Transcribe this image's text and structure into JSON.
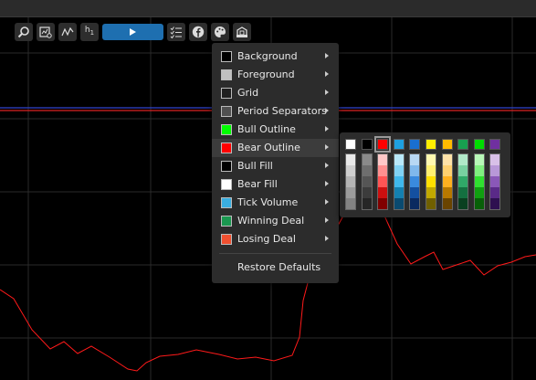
{
  "chart": {
    "background": "#000000",
    "grid_color": "#2a2a2a",
    "line_color": "#ff1a1a",
    "hline_blue": "#3344cc",
    "hline_red": "#dd2222"
  },
  "toolbar": {
    "icons": [
      "zoom-icon",
      "chart-settings-icon",
      "indicator-icon",
      "timeframe-icon",
      "play-icon",
      "checklist-icon",
      "facebook-icon",
      "color-palette-icon",
      "template-icon"
    ],
    "timeframe_letter": "h",
    "timeframe_number": "1",
    "play_color": "#1e6fb0"
  },
  "menu": {
    "items": [
      {
        "label": "Background",
        "color": "#000000"
      },
      {
        "label": "Foreground",
        "color": "#c0c0c0"
      },
      {
        "label": "Grid",
        "color": "#202020"
      },
      {
        "label": "Period Separators",
        "color": "#505050"
      },
      {
        "label": "Bull Outline",
        "color": "#00ff00"
      },
      {
        "label": "Bear Outline",
        "color": "#ff0000"
      },
      {
        "label": "Bull Fill",
        "color": "#000000"
      },
      {
        "label": "Bear Fill",
        "color": "#ffffff"
      },
      {
        "label": "Tick Volume",
        "color": "#3aaee0"
      },
      {
        "label": "Winning Deal",
        "color": "#1a9850"
      },
      {
        "label": "Losing Deal",
        "color": "#f05030"
      }
    ],
    "highlighted_index": 5,
    "restore_label": "Restore Defaults"
  },
  "palette": {
    "top_colors": [
      "#ffffff",
      "#000000",
      "#ff0000",
      "#1ea0e0",
      "#1a6fd0",
      "#ffee00",
      "#ffbb00",
      "#18a050",
      "#00dd00",
      "#7030a0"
    ],
    "selected_index": 2,
    "shades": [
      [
        "#e8e8e8",
        "#cfcfcf",
        "#b5b5b5",
        "#9c9c9c",
        "#838383"
      ],
      [
        "#8a8a8a",
        "#6e6e6e",
        "#555555",
        "#3c3c3c",
        "#262626"
      ],
      [
        "#ffc8c8",
        "#ff9090",
        "#ff5555",
        "#cc1010",
        "#800000"
      ],
      [
        "#b8e8fa",
        "#80d2f4",
        "#40b8ec",
        "#1480b0",
        "#0a4a70"
      ],
      [
        "#b8d8f4",
        "#80b8ec",
        "#3a8ade",
        "#1450a0",
        "#0a2a60"
      ],
      [
        "#fff8b0",
        "#fff070",
        "#ffe000",
        "#c0a800",
        "#706000"
      ],
      [
        "#ffe2a8",
        "#ffd070",
        "#ffb020",
        "#b87800",
        "#6a4400"
      ],
      [
        "#b0e8c8",
        "#78d0a0",
        "#30a868",
        "#147040",
        "#0a4020"
      ],
      [
        "#b8f8b8",
        "#80f080",
        "#30e030",
        "#10a010",
        "#086008"
      ],
      [
        "#d8c0e8",
        "#b898d8",
        "#8a58b8",
        "#5a2a88",
        "#2e1050"
      ]
    ]
  }
}
